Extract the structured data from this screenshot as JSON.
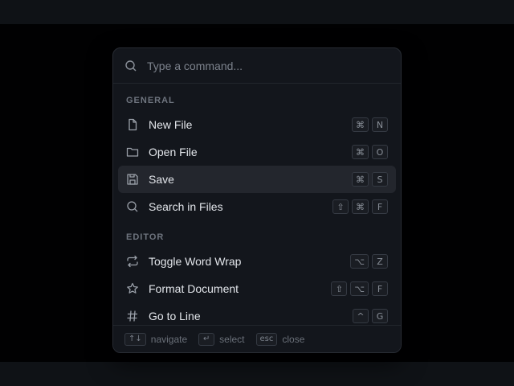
{
  "search": {
    "placeholder": "Type a command..."
  },
  "sections": [
    {
      "title": "GENERAL",
      "items": [
        {
          "label": "New File",
          "icon": "file-icon",
          "keys": [
            "⌘",
            "N"
          ]
        },
        {
          "label": "Open File",
          "icon": "folder-icon",
          "keys": [
            "⌘",
            "O"
          ]
        },
        {
          "label": "Save",
          "icon": "save-icon",
          "keys": [
            "⌘",
            "S"
          ],
          "active": true
        },
        {
          "label": "Search in Files",
          "icon": "search-icon",
          "keys": [
            "⇧",
            "⌘",
            "F"
          ]
        }
      ]
    },
    {
      "title": "EDITOR",
      "items": [
        {
          "label": "Toggle Word Wrap",
          "icon": "repeat-icon",
          "keys": [
            "⌥",
            "Z"
          ]
        },
        {
          "label": "Format Document",
          "icon": "star-icon",
          "keys": [
            "⇧",
            "⌥",
            "F"
          ]
        },
        {
          "label": "Go to Line",
          "icon": "hash-icon",
          "keys": [
            "^",
            "G"
          ]
        }
      ]
    }
  ],
  "footer": {
    "navigate": {
      "key": "↑↓",
      "label": "navigate"
    },
    "select": {
      "key": "↵",
      "label": "select"
    },
    "close": {
      "key": "esc",
      "label": "close"
    }
  }
}
